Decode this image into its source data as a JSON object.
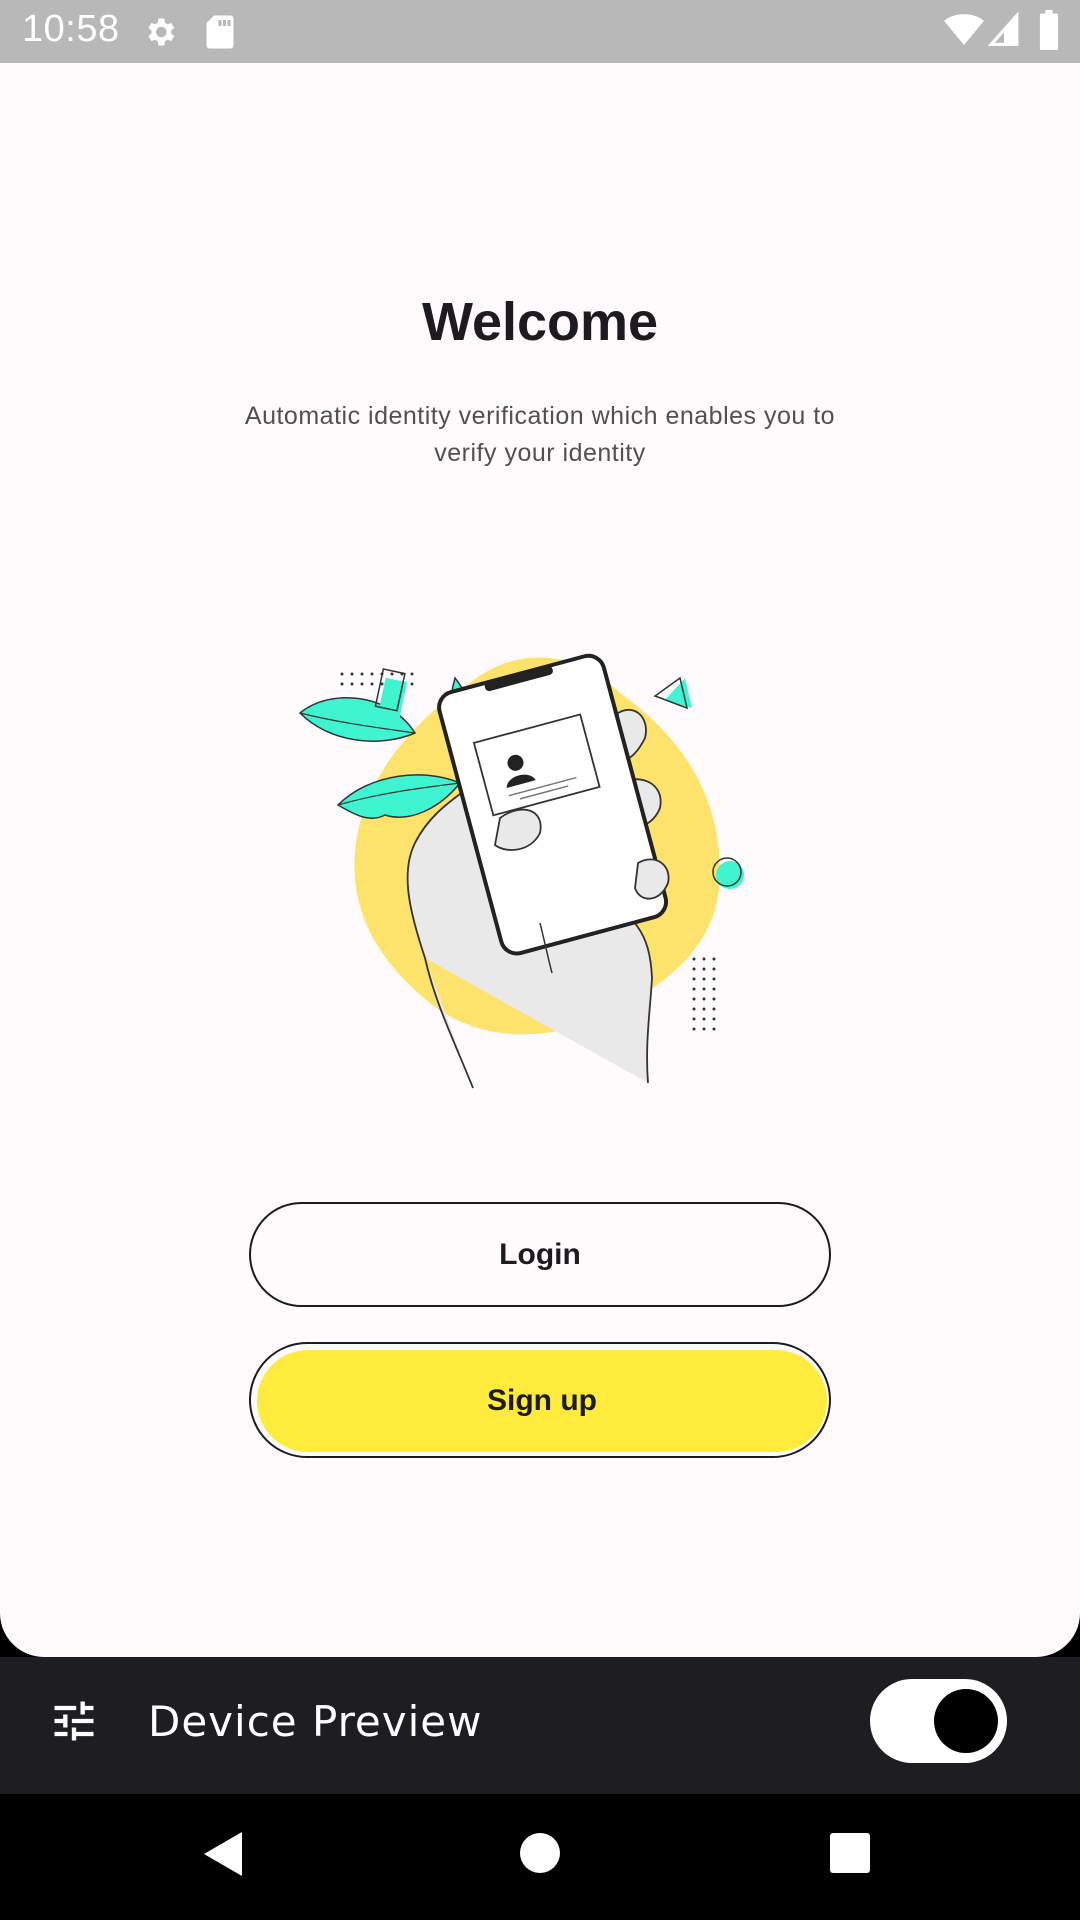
{
  "status_bar": {
    "time": "10:58",
    "icons": [
      "settings-icon",
      "sd-card-icon",
      "wifi-icon",
      "signal-icon",
      "battery-icon"
    ]
  },
  "welcome": {
    "title": "Welcome",
    "subtitle": "Automatic identity verification which enables you to verify your identity"
  },
  "buttons": {
    "login_label": "Login",
    "signup_label": "Sign up"
  },
  "device_preview": {
    "label": "Device Preview",
    "toggle_on": true,
    "icon": "tune-icon"
  },
  "nav_bar": {
    "icons": [
      "back-icon",
      "home-icon",
      "recents-icon"
    ]
  },
  "colors": {
    "accent_yellow": "#ffeb3b",
    "blob_yellow": "#fde36b",
    "mint": "#3ff5d1",
    "dark_bar": "#1e1d22",
    "surface": "#fffbfd"
  }
}
